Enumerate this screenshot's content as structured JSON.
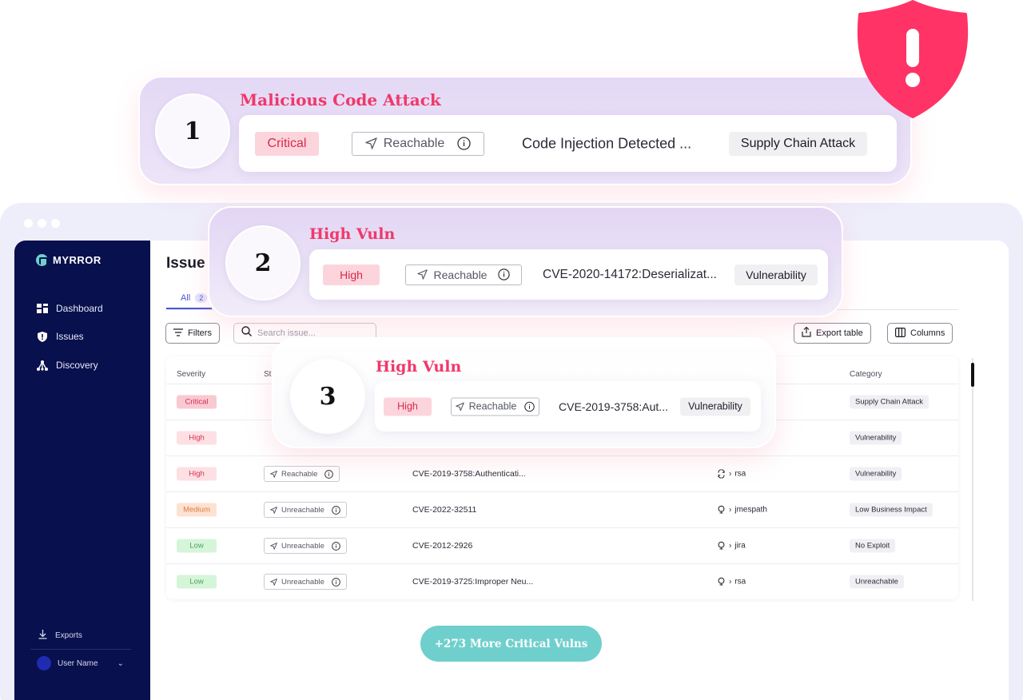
{
  "sidebar": {
    "logo": "MYRROR",
    "items": [
      {
        "label": "Dashboard",
        "icon": "dashboard-icon"
      },
      {
        "label": "Issues",
        "icon": "shield-icon"
      },
      {
        "label": "Discovery",
        "icon": "discovery-icon"
      }
    ],
    "exports": "Exports",
    "user": "User Name"
  },
  "main": {
    "title": "Issue",
    "tab_all": "All",
    "tab_all_count": "2",
    "filters": "Filters",
    "search_placeholder": "Search issue...",
    "export_table": "Export table",
    "columns": "Columns",
    "more_button": "+273 More Critical Vulns"
  },
  "table": {
    "headers": {
      "severity": "Severity",
      "status": "St",
      "category": "Category"
    },
    "rows": [
      {
        "severity": "Critical",
        "sev_class": "critical",
        "reach": "",
        "name": "",
        "package": "",
        "pkg_icon": "",
        "category": "Supply Chain Attack"
      },
      {
        "severity": "High",
        "sev_class": "high",
        "reach": "",
        "name": "",
        "package": "",
        "pkg_icon": "",
        "category": "Vulnerability"
      },
      {
        "severity": "High",
        "sev_class": "high",
        "reach": "Reachable",
        "name": "CVE-2019-3758:Authenticati...",
        "package": "rsa",
        "pkg_icon": "sync-icon",
        "category": "Vulnerability"
      },
      {
        "severity": "Medium",
        "sev_class": "medium",
        "reach": "Unreachable",
        "name": "CVE-2022-32511",
        "package": "jmespath",
        "pkg_icon": "bulb-icon",
        "category": "Low Business Impact"
      },
      {
        "severity": "Low",
        "sev_class": "low",
        "reach": "Unreachable",
        "name": "CVE-2012-2926",
        "package": "jira",
        "pkg_icon": "bulb-icon",
        "category": "No Exploit"
      },
      {
        "severity": "Low",
        "sev_class": "low",
        "reach": "Unreachable",
        "name": "CVE-2019-3725:Improper Neu...",
        "package": "rsa",
        "pkg_icon": "bulb-icon",
        "category": "Unreachable"
      }
    ]
  },
  "cards": [
    {
      "num": "1",
      "title": "Malicious Code Attack",
      "severity": "Critical",
      "reach": "Reachable",
      "name": "Code Injection Detected ...",
      "category": "Supply Chain Attack"
    },
    {
      "num": "2",
      "title": "High Vuln",
      "severity": "High",
      "reach": "Reachable",
      "name": "CVE-2020-14172:Deserializat...",
      "category": "Vulnerability"
    },
    {
      "num": "3",
      "title": "High Vuln",
      "severity": "High",
      "reach": "Reachable",
      "name": "CVE-2019-3758:Aut...",
      "category": "Vulnerability"
    }
  ],
  "colors": {
    "accent": "#f0386a",
    "sidebar": "#08104d",
    "teal": "#6fcfcc",
    "shield": "#ff3366"
  }
}
